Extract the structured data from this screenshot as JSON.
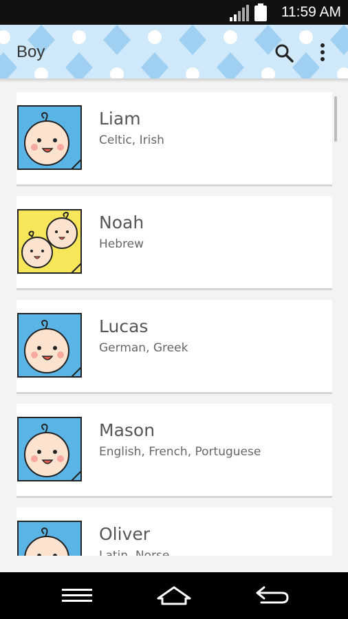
{
  "status_bar": {
    "time": "11:59 AM"
  },
  "app_bar": {
    "title": "Boy",
    "icons": [
      "search-icon",
      "more-vertical-icon"
    ]
  },
  "names": [
    {
      "name": "Liam",
      "origin": "Celtic, Irish",
      "thumb": "blue-baby-card"
    },
    {
      "name": "Noah",
      "origin": "Hebrew",
      "thumb": "yellow-twins-card"
    },
    {
      "name": "Lucas",
      "origin": "German, Greek",
      "thumb": "blue-baby-card"
    },
    {
      "name": "Mason",
      "origin": "English, French, Portuguese",
      "thumb": "blue-baby-card"
    },
    {
      "name": "Oliver",
      "origin": "Latin, Norse",
      "thumb": "blue-baby-card"
    }
  ],
  "nav_bar": {
    "icons": [
      "menu-icon",
      "home-icon",
      "back-icon"
    ]
  },
  "colors": {
    "app_bar_bg": "#cfe8fa",
    "blue_card": "#5bb4e6",
    "yellow_card": "#f7e65a"
  }
}
